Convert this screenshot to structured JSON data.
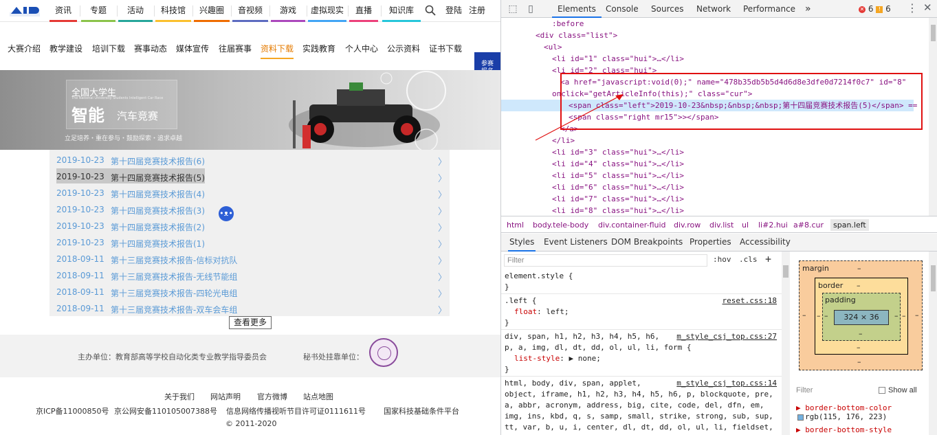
{
  "site": {
    "nav": [
      "资讯",
      "专题",
      "活动",
      "科技馆",
      "兴趣圈",
      "音视频",
      "游戏",
      "虚拟现实",
      "直播",
      "知识库"
    ],
    "nav_colors": [
      "#e53935",
      "#8bc34a",
      "#26a69a",
      "#fbc02d",
      "#ef6c00",
      "#5c6bc0",
      "#ab47bc",
      "#42a5f5",
      "#ec407a",
      "#26c6da"
    ],
    "login": "登陆",
    "register": "注册",
    "subnav": [
      "大赛介绍",
      "教学建设",
      "培训下载",
      "赛事动态",
      "媒体宣传",
      "往届赛事",
      "资料下载",
      "实践教育",
      "个人中心",
      "公示资料",
      "证书下载"
    ],
    "subnav_active": "资料下载",
    "signup": "参赛报名",
    "banner": {
      "line1": "全国大学生",
      "line2": "The National University Students Intelligent Car Race",
      "line3": "智能",
      "line3b": "汽车竞赛",
      "slogan": "立足培养・重在参与・鼓励探索・追求卓越"
    },
    "articles": [
      {
        "date": "2019-10-23",
        "title": "第十四届竞赛技术报告(6)"
      },
      {
        "date": "2019-10-23",
        "title": "第十四届竞赛技术报告(5)"
      },
      {
        "date": "2019-10-23",
        "title": "第十四届竞赛技术报告(4)"
      },
      {
        "date": "2019-10-23",
        "title": "第十四届竞赛技术报告(3)"
      },
      {
        "date": "2019-10-23",
        "title": "第十四届竞赛技术报告(2)"
      },
      {
        "date": "2019-10-23",
        "title": "第十四届竞赛技术报告(1)"
      },
      {
        "date": "2018-09-11",
        "title": "第十三届竞赛技术报告-信标对抗队"
      },
      {
        "date": "2018-09-11",
        "title": "第十三届竞赛技术报告-无线节能组"
      },
      {
        "date": "2018-09-11",
        "title": "第十三届竞赛技术报告-四轮光电组"
      },
      {
        "date": "2018-09-11",
        "title": "第十三届竞赛技术报告-双车会车组"
      }
    ],
    "selected_index": 1,
    "more": "查看更多",
    "host": "主办单位：教育部高等学校自动化类专业教学指导委员会",
    "secretariat": "秘书处挂靠单位：",
    "footer_links": [
      "关于我们",
      "网站声明",
      "官方微博",
      "站点地图"
    ],
    "footer_lines": [
      "京ICP备11000850号",
      "京公网安备110105007388号",
      "信息网络传播视听节目许可证0111611号",
      "国家科技基础条件平台"
    ],
    "copyright": "©  2011-2020"
  },
  "devtools": {
    "tabs": [
      "Elements",
      "Console",
      "Sources",
      "Network",
      "Performance"
    ],
    "active_tab": "Elements",
    "errors": "6",
    "warnings": "6",
    "lines": [
      {
        "t": ":before",
        "indent": 7
      },
      {
        "t": "<div class=\"list\">",
        "indent": 5
      },
      {
        "t": "<ul>",
        "indent": 6
      },
      {
        "t": "<li id=\"1\" class=\"hui\">…</li>",
        "indent": 7
      },
      {
        "t": "<li id=\"2\" class=\"hui\">",
        "indent": 7
      },
      {
        "t": "<a href=\"javascript:void(0);\" name=\"478b35db5b5d4d6d8e3dfe0d7214f0c7\" id=\"8\"",
        "indent": 8
      },
      {
        "t": "onclick=\"getArticleInfo(this);\" class=\"cur\">",
        "indent": 7
      },
      {
        "t": "<span class=\"left\">2019-10-23&nbsp;&nbsp;&nbsp;第十四届竞赛技术报告(5)</span> ==",
        "indent": 9
      },
      {
        "t": "<span class=\"right mr15\">></span>",
        "indent": 9
      },
      {
        "t": "</a>",
        "indent": 8
      },
      {
        "t": "</li>",
        "indent": 7
      },
      {
        "t": "<li id=\"3\" class=\"hui\">…</li>",
        "indent": 7
      },
      {
        "t": "<li id=\"4\" class=\"hui\">…</li>",
        "indent": 7
      },
      {
        "t": "<li id=\"5\" class=\"hui\">…</li>",
        "indent": 7
      },
      {
        "t": "<li id=\"6\" class=\"hui\">…</li>",
        "indent": 7
      },
      {
        "t": "<li id=\"7\" class=\"hui\">…</li>",
        "indent": 7
      },
      {
        "t": "<li id=\"8\" class=\"hui\">…</li>",
        "indent": 7
      }
    ],
    "breadcrumbs": [
      "html",
      "body.tele-body",
      "div.container-fluid",
      "div.row",
      "div.list",
      "ul",
      "li#2.hui",
      "a#8.cur",
      "span.left"
    ],
    "pane_tabs": [
      "Styles",
      "Event Listeners",
      "DOM Breakpoints",
      "Properties",
      "Accessibility"
    ],
    "filter_placeholder": "Filter",
    "hov": ":hov",
    "cls": ".cls",
    "rules": [
      {
        "selector": "element.style {",
        "props": [],
        "source": ""
      },
      {
        "selector": ".left {",
        "props": [
          {
            "p": "float",
            "v": "left"
          }
        ],
        "source": "reset.css:18"
      },
      {
        "selector": "div, span, h1, h2, h3, h4, h5, h6,",
        "props": [
          {
            "p": "list-style",
            "v": "▶ none"
          }
        ],
        "source": "m_style_csj_top.css:27",
        "extra": "p, a, img, dl, dt, dd, ol, ul, li, form {"
      },
      {
        "selector": "html, body, div, span, applet,",
        "props": [],
        "source": "m_style_csj_top.css:14",
        "extra": "object, iframe, h1, h2, h3, h4, h5, h6, p, blockquote, pre, a, abbr, acronym, address, big, cite, code, del, dfn, em, img, ins, kbd, q, s, samp, small, strike, strong, sub, sup, tt, var, b, u, i, center, dl, dt, dd, ol, ul, li, fieldset, form, label, legend, table, caption, tbody, tfoot, thead,"
      }
    ],
    "box": {
      "margin": "margin",
      "border": "border",
      "padding": "padding",
      "content": "324 × 36",
      "dash": "–"
    },
    "computed_filter": "Filter",
    "show_all": "Show all",
    "computed": [
      {
        "p": "border-bottom-color",
        "v": "rgb(115, 176, 223)",
        "swatch": "#73b0df"
      },
      {
        "p": "border-bottom-style",
        "v": ""
      }
    ]
  }
}
